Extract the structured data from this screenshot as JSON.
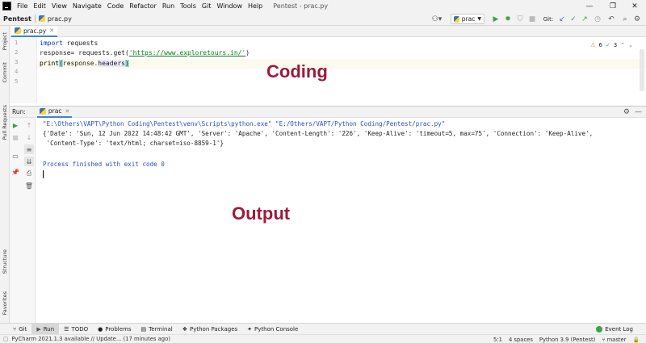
{
  "menu": [
    "File",
    "Edit",
    "View",
    "Navigate",
    "Code",
    "Refactor",
    "Run",
    "Tools",
    "Git",
    "Window",
    "Help"
  ],
  "window_title": "Pentest - prac.py",
  "breadcrumb": {
    "project": "Pentest",
    "file": "prac.py"
  },
  "run_config": "prac",
  "git_label": "Git:",
  "editor_tab": "prac.py",
  "inspections": {
    "warnings": "6",
    "checks": "3"
  },
  "line_numbers": [
    "1",
    "2",
    "3",
    "4",
    "5"
  ],
  "code": {
    "line1_kw": "import",
    "line1_rest": " requests",
    "line2_start": "response= requests.get(",
    "line2_url": "'https://www.exploretours.in/'",
    "line2_end": ")",
    "line3_fn": "print",
    "line3_open": "(",
    "line3_mid": "response.",
    "line3_attr": "headers",
    "line3_close": ")"
  },
  "overlay_coding": "Coding",
  "overlay_output": "Output",
  "run_panel": {
    "label": "Run:",
    "tab": "prac"
  },
  "console": {
    "command": "\"E:\\Others\\VAPT\\Python Coding\\Pentest\\venv\\Scripts\\python.exe\" \"E:/Others/VAPT/Python Coding/Pentest/prac.py\"",
    "output_line1": "{'Date': 'Sun, 12 Jun 2022 14:48:42 GMT', 'Server': 'Apache', 'Content-Length': '226', 'Keep-Alive': 'timeout=5, max=75', 'Connection': 'Keep-Alive',",
    "output_line2": " 'Content-Type': 'text/html; charset=iso-8859-1'}",
    "exit_message": "Process finished with exit code 0"
  },
  "left_tabs": {
    "project": "Project",
    "commit": "Commit",
    "pull_requests": "Pull Requests",
    "structure": "Structure",
    "favorites": "Favorites"
  },
  "bottom_tools": [
    "Git",
    "Run",
    "TODO",
    "Problems",
    "Terminal",
    "Python Packages",
    "Python Console"
  ],
  "event_log": "Event Log",
  "status": {
    "message": "PyCharm 2021.1.3 available // Update... (17 minutes ago)",
    "position": "5:1",
    "indent": "4 spaces",
    "interpreter": "Python 3.9 (Pentest)",
    "branch": "master"
  },
  "colors": {
    "accent": "#4083c9",
    "overlay": "#9b1c3b",
    "console_blue": "#2a4fbd",
    "run_green": "#3ea04a"
  }
}
